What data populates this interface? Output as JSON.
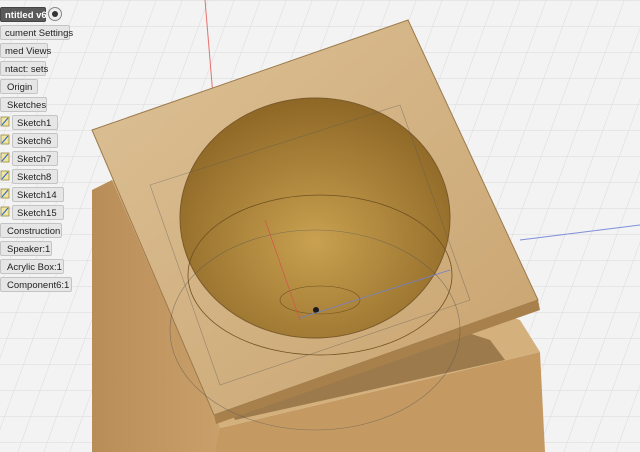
{
  "document": {
    "title": "ntitled v6"
  },
  "browser": {
    "items": [
      {
        "label": "cument Settings"
      },
      {
        "label": "med Views"
      },
      {
        "label": "ntact: sets"
      },
      {
        "label": "Origin"
      },
      {
        "label": "Sketches"
      },
      {
        "label": "Sketch1"
      },
      {
        "label": "Sketch6"
      },
      {
        "label": "Sketch7"
      },
      {
        "label": "Sketch8"
      },
      {
        "label": "Sketch14"
      },
      {
        "label": "Sketch15"
      },
      {
        "label": "Construction"
      },
      {
        "label": "Speaker:1"
      },
      {
        "label": "Acrylic Box:1"
      },
      {
        "label": "Component6:1"
      }
    ]
  },
  "colors": {
    "grid_bg": "#f3f3f3",
    "grid_line": "#dcdcdc",
    "wood_light": "#d9b887",
    "wood_dark": "#b48a55",
    "interior": "#b58a3e",
    "axis_red": "#e05050",
    "axis_blue": "#6a7fd6"
  },
  "icons": {
    "visibility": "eye-icon",
    "sketch": "sketch-icon"
  }
}
